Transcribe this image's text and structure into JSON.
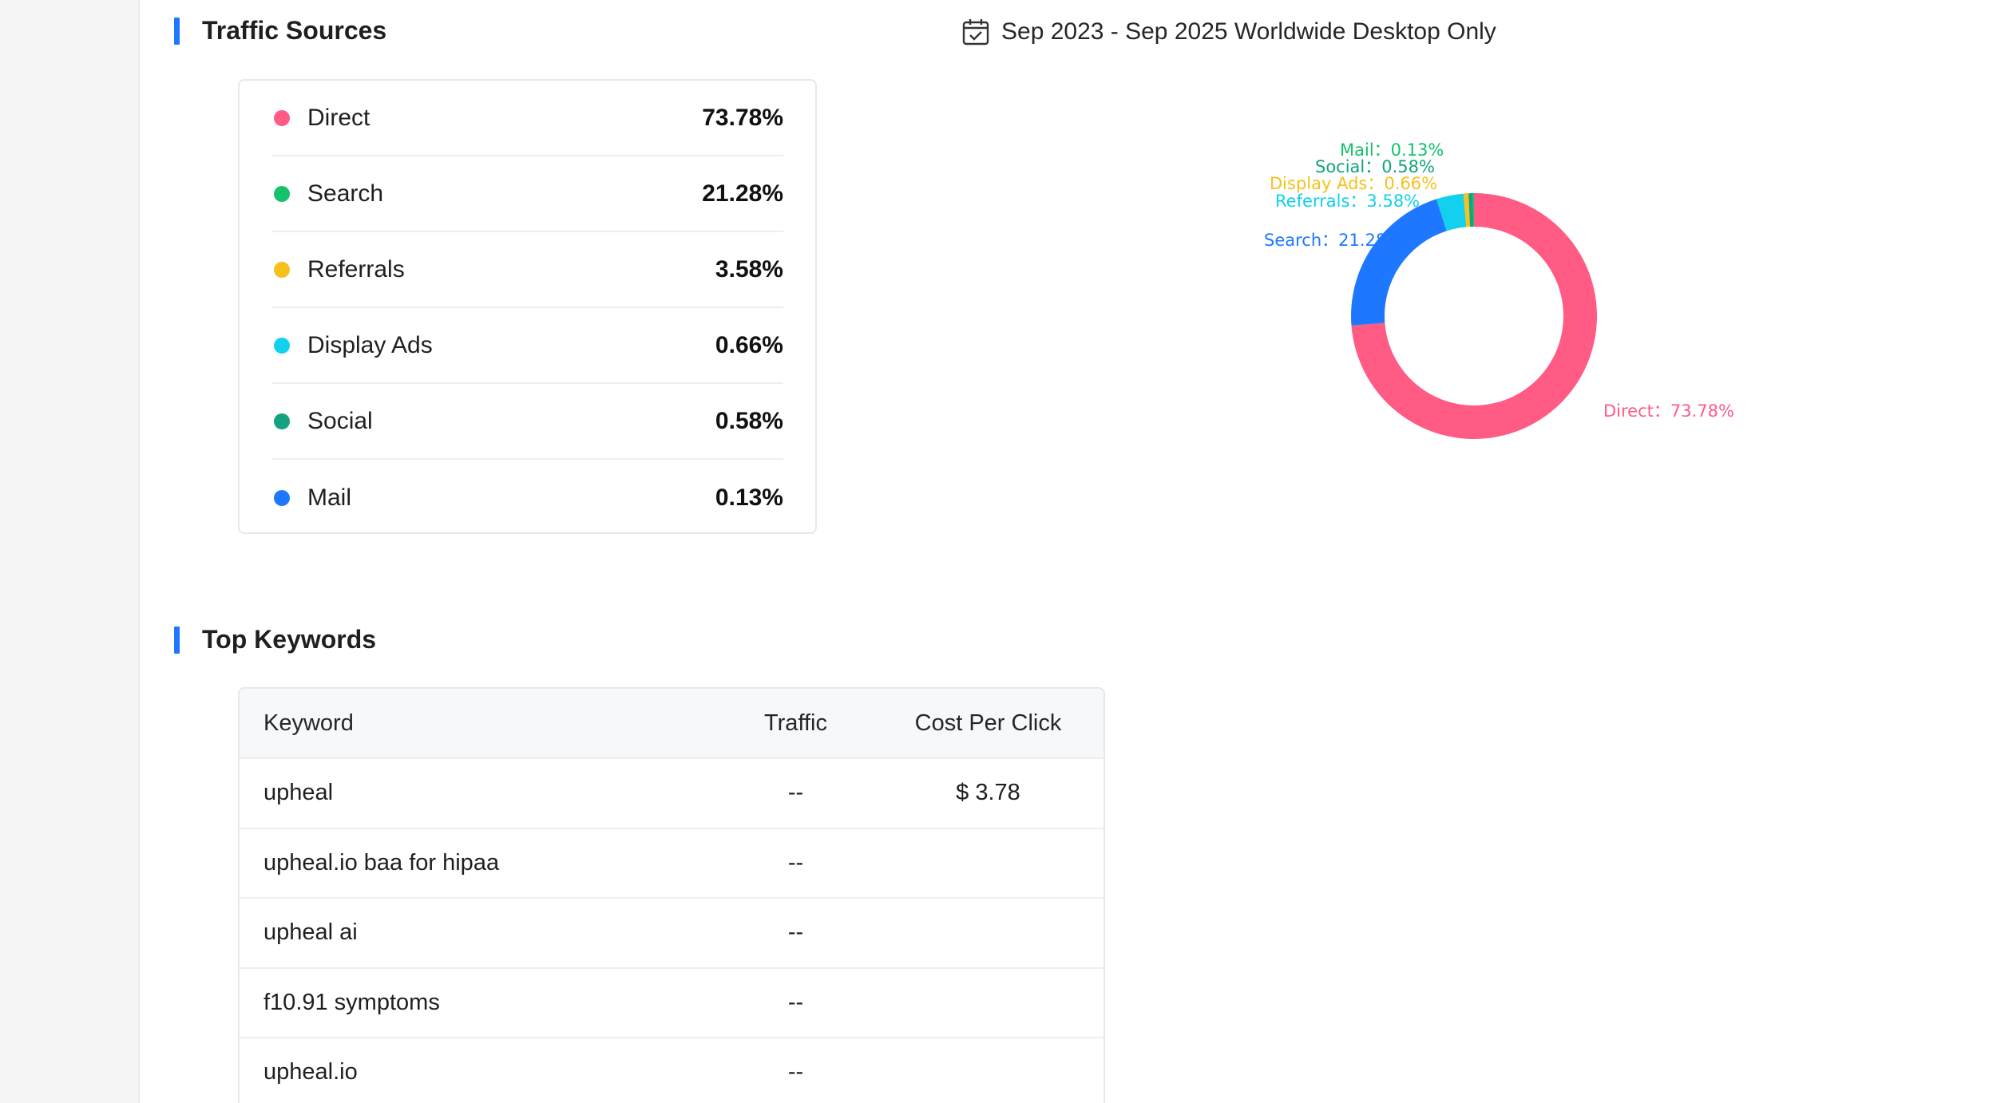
{
  "traffic": {
    "title": "Traffic Sources",
    "date_range": "Sep 2023 - Sep 2025 Worldwide Desktop Only",
    "sources": [
      {
        "name": "Direct",
        "value": "73.78%",
        "color": "#ff5b85"
      },
      {
        "name": "Search",
        "value": "21.28%",
        "color": "#15c26b"
      },
      {
        "name": "Referrals",
        "value": "3.58%",
        "color": "#f7c01a"
      },
      {
        "name": "Display Ads",
        "value": "0.66%",
        "color": "#12d0ee"
      },
      {
        "name": "Social",
        "value": "0.58%",
        "color": "#14a37f"
      },
      {
        "name": "Mail",
        "value": "0.13%",
        "color": "#1e78ff"
      }
    ]
  },
  "chart_data": {
    "type": "pie",
    "donut": true,
    "categories": [
      "Direct",
      "Search",
      "Referrals",
      "Display Ads",
      "Social",
      "Mail"
    ],
    "values": [
      73.78,
      21.28,
      3.58,
      0.66,
      0.58,
      0.13
    ],
    "colors": [
      "#ff5b85",
      "#1e78ff",
      "#12d0ee",
      "#f7c01a",
      "#14a37f",
      "#15c26b"
    ],
    "labels": [
      "Direct：73.78%",
      "Search：21.28%",
      "Referrals：3.58%",
      "Display Ads：0.66%",
      "Social：0.58%",
      "Mail：0.13%"
    ]
  },
  "keywords": {
    "title": "Top Keywords",
    "headers": {
      "keyword": "Keyword",
      "traffic": "Traffic",
      "cpc": "Cost Per Click"
    },
    "rows": [
      {
        "keyword": "upheal",
        "traffic": "--",
        "cpc": "$ 3.78"
      },
      {
        "keyword": "upheal.io baa for hipaa",
        "traffic": "--",
        "cpc": ""
      },
      {
        "keyword": "upheal ai",
        "traffic": "--",
        "cpc": ""
      },
      {
        "keyword": "f10.91 symptoms",
        "traffic": "--",
        "cpc": ""
      },
      {
        "keyword": "upheal.io",
        "traffic": "--",
        "cpc": ""
      }
    ]
  },
  "icons": {
    "date": "calendar-check-icon"
  }
}
